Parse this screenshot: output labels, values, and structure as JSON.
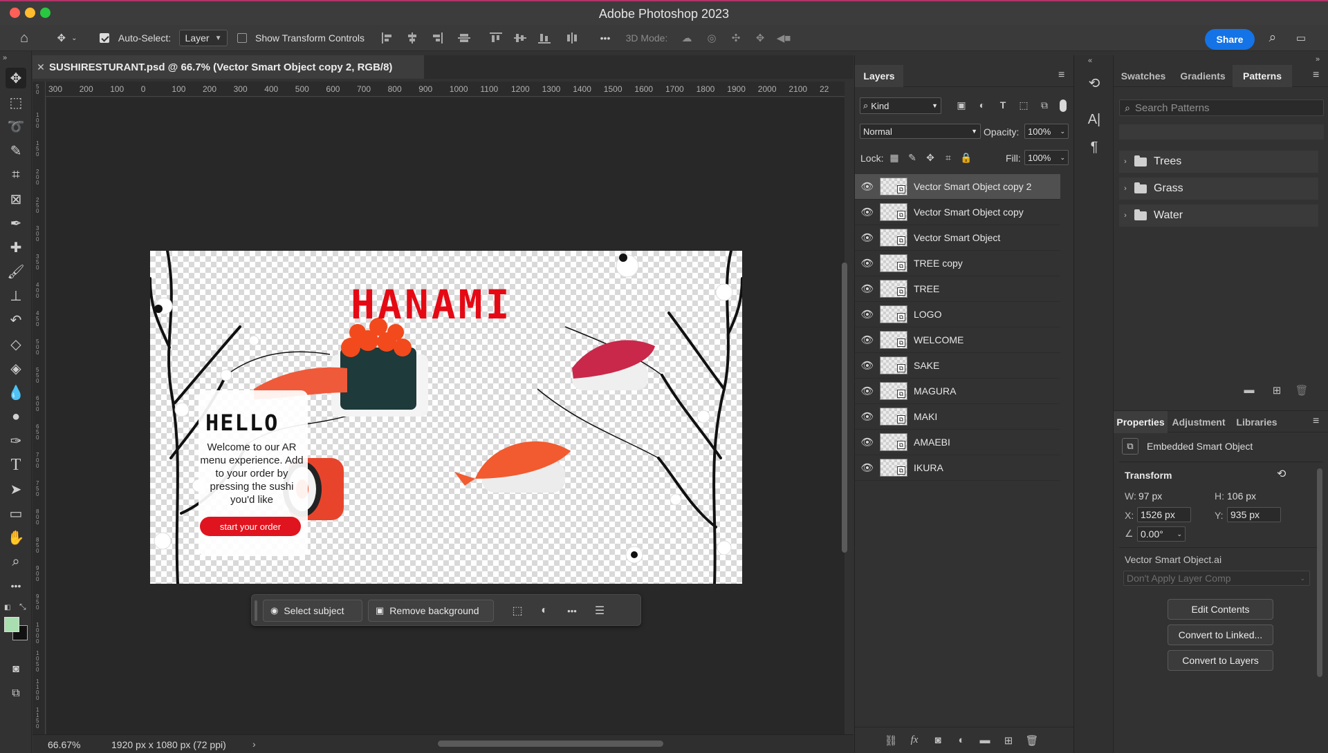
{
  "window": {
    "title": "Adobe Photoshop 2023",
    "traffic_colors": [
      "#fe5f57",
      "#febc2e",
      "#28c840"
    ]
  },
  "options": {
    "auto_select_label": "Auto-Select:",
    "auto_select_checked": true,
    "auto_select_value": "Layer",
    "show_transform_label": "Show Transform Controls",
    "show_transform_checked": false,
    "mode_3d_label": "3D Mode:",
    "more_label": "•••",
    "share_label": "Share"
  },
  "document": {
    "tab_title": "SUSHIRESTURANT.psd @ 66.7% (Vector Smart Object copy 2, RGB/8)",
    "ruler_ticks": [
      "300",
      "200",
      "100",
      "0",
      "100",
      "200",
      "300",
      "400",
      "500",
      "600",
      "700",
      "800",
      "900",
      "1000",
      "1100",
      "1200",
      "1300",
      "1400",
      "1500",
      "1600",
      "1700",
      "1800",
      "1900",
      "2000",
      "2100",
      "22"
    ],
    "vertical_ruler_ticks": [
      "5 0",
      "1 0 0",
      "1 5 0",
      "2 0 0",
      "2 5 0",
      "3 0 0",
      "3 5 0",
      "4 0 0",
      "4 5 0",
      "5 0 0",
      "5 5 0",
      "6 0 0",
      "6 5 0",
      "7 0 0",
      "7 5 0",
      "8 0 0",
      "8 5 0",
      "9 0 0",
      "9 5 0",
      "1 0 0 0",
      "1 0 5 0",
      "1 1 0 0",
      "1 1 5 0"
    ],
    "canvas": {
      "logo_text": "HANAMI",
      "hello_text": "HELLO",
      "welcome_text": "Welcome to our AR menu experience. Add to your order by pressing the sushi you'd like",
      "order_button": "start your order",
      "accent_color": "#e50914"
    }
  },
  "taskbar": {
    "select_subject": "Select subject",
    "remove_background": "Remove background",
    "more": "•••"
  },
  "status": {
    "zoom": "66.67%",
    "doc_size": "1920 px x 1080 px (72 ppi)",
    "arrow": "›"
  },
  "layers": {
    "tab_label": "Layers",
    "filter_kind": "Kind",
    "blend_mode": "Normal",
    "opacity_label": "Opacity:",
    "opacity_value": "100%",
    "lock_label": "Lock:",
    "fill_label": "Fill:",
    "fill_value": "100%",
    "items": [
      {
        "name": "Vector Smart Object copy 2",
        "selected": true
      },
      {
        "name": "Vector Smart Object copy",
        "selected": false
      },
      {
        "name": "Vector Smart Object",
        "selected": false
      },
      {
        "name": "TREE copy",
        "selected": false
      },
      {
        "name": "TREE",
        "selected": false
      },
      {
        "name": "LOGO",
        "selected": false
      },
      {
        "name": "WELCOME",
        "selected": false
      },
      {
        "name": "SAKE",
        "selected": false
      },
      {
        "name": "MAGURA",
        "selected": false
      },
      {
        "name": "MAKI",
        "selected": false
      },
      {
        "name": "AMAEBI",
        "selected": false
      },
      {
        "name": "IKURA",
        "selected": false
      }
    ]
  },
  "patterns": {
    "tabs": [
      "Swatches",
      "Gradients",
      "Patterns"
    ],
    "active_tab": "Patterns",
    "search_placeholder": "Search Patterns",
    "folders": [
      "Trees",
      "Grass",
      "Water"
    ]
  },
  "properties": {
    "tabs": [
      "Properties",
      "Adjustment",
      "Libraries"
    ],
    "type_label": "Embedded Smart Object",
    "transform_label": "Transform",
    "w_label": "W:",
    "w_value": "97 px",
    "h_label": "H:",
    "h_value": "106 px",
    "x_label": "X:",
    "x_value": "1526 px",
    "y_label": "Y:",
    "y_value": "935 px",
    "angle_value": "0.00°",
    "source_file": "Vector Smart Object.ai",
    "layer_comp_placeholder": "Don't Apply Layer Comp",
    "buttons": [
      "Edit Contents",
      "Convert to Linked...",
      "Convert to Layers"
    ]
  },
  "colors": {
    "foreground": "#a9dfb0",
    "background": "#111111",
    "share": "#1473e6"
  }
}
